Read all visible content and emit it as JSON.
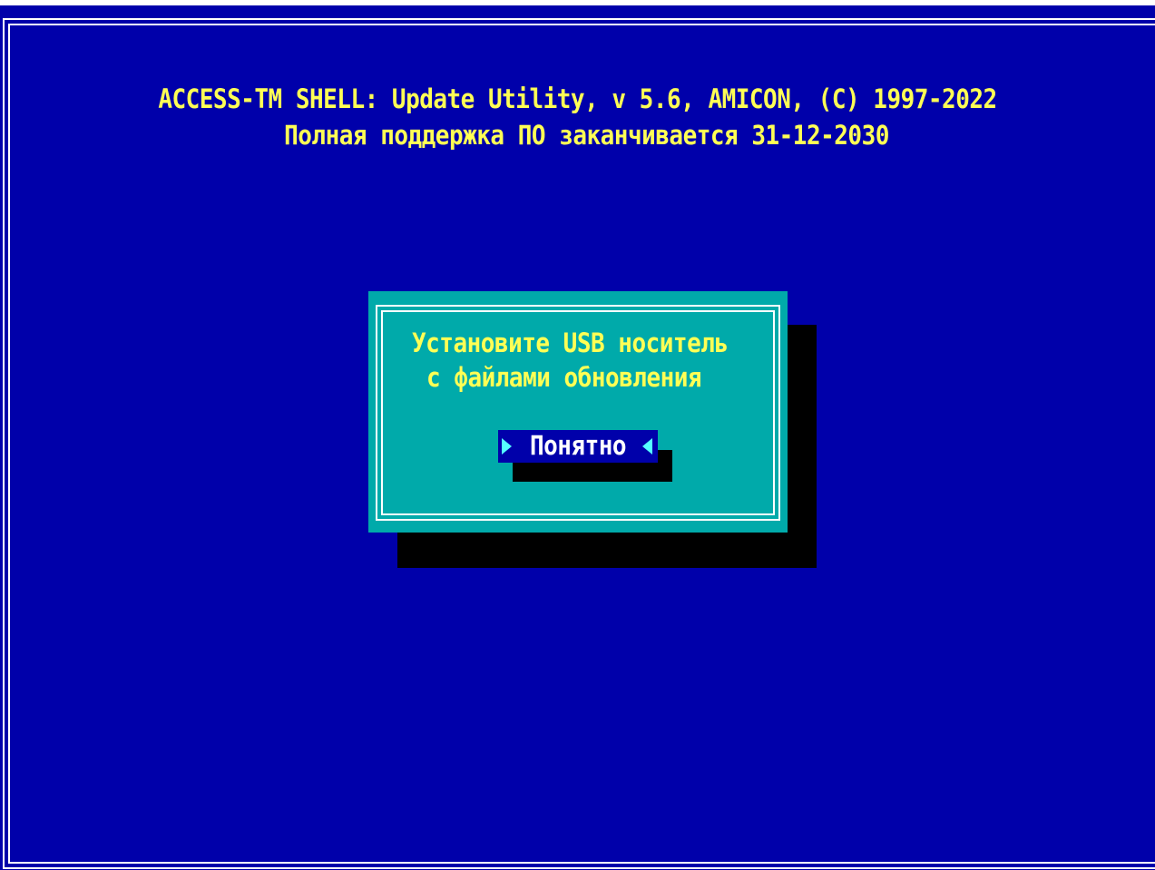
{
  "header": {
    "line1": "ACCESS-TM SHELL: Update Utility, v 5.6, AMICON, (C) 1997-2022",
    "line2": "Полная поддержка ПО заканчивается 31-12-2030"
  },
  "dialog": {
    "message_line1": "Установите USB носитель",
    "message_line2": "с файлами обновления",
    "ok_button_label": "Понятно"
  },
  "colors": {
    "screen_background": "#0000AA",
    "header_text": "#FFFF55",
    "dialog_background": "#00AAAA",
    "dialog_text": "#FFFF55",
    "button_background": "#0000AA",
    "button_text": "#FFFFFF",
    "button_arrows": "#55FFFF",
    "shadow": "#000000"
  },
  "icons": {
    "button_left": "triangle-right-icon",
    "button_right": "triangle-left-icon"
  }
}
